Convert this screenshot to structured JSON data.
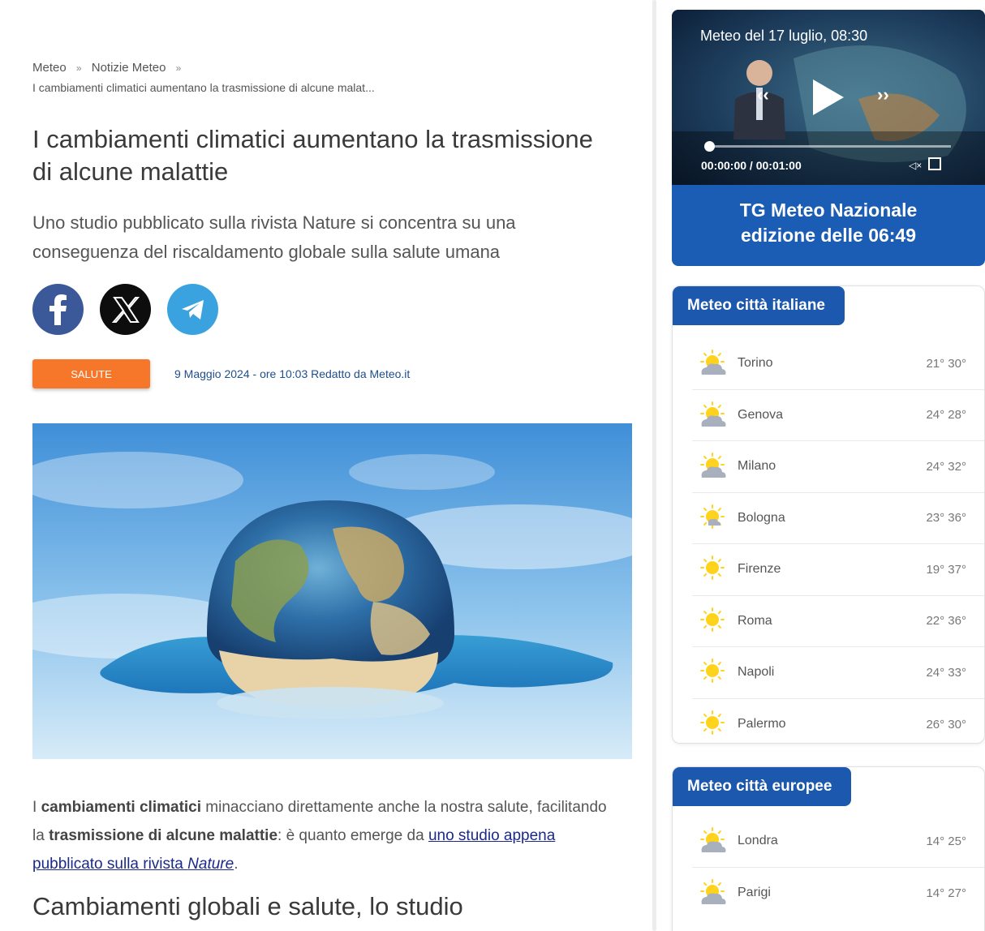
{
  "breadcrumb": {
    "items": [
      "Meteo",
      "Notizie Meteo"
    ],
    "separator": "»",
    "current": "I cambiamenti climatici aumentano la trasmissione di alcune malat..."
  },
  "article": {
    "title": "I cambiamenti climatici aumentano la trasmissione di alcune malattie",
    "subtitle": "Uno studio pubblicato sulla rivista Nature si concentra su una conseguenza del riscaldamento globale sulla salute umana",
    "share": [
      "facebook-icon",
      "x-icon",
      "telegram-icon"
    ],
    "tag": "SALUTE",
    "dateline": "9 Maggio 2024 - ore 10:03 Redatto da Meteo.it",
    "body": {
      "t1": "I ",
      "b1": "cambiamenti climatici",
      "t2": " minacciano direttamente anche la nostra salute, facilitando la ",
      "b2": "trasmissione di alcune malattie",
      "t3": ": è quanto emerge da ",
      "link1": "uno studio appena pubblicato sulla rivista ",
      "link_italic": "Nature",
      "t4": "."
    },
    "section_heading": "Cambiamenti globali e salute, lo studio"
  },
  "video": {
    "title": "Meteo del 17 luglio, 08:30",
    "timecode": "00:00:00 / 00:01:00",
    "progress": 0,
    "mute_label": "◁×",
    "caption_line1": "TG Meteo Nazionale",
    "caption_line2": "edizione delle 06:49"
  },
  "cities_it": {
    "title": "Meteo città italiane",
    "rows": [
      {
        "name": "Torino",
        "temps": "21° 30°",
        "icon": "sun-cloud-icon"
      },
      {
        "name": "Genova",
        "temps": "24° 28°",
        "icon": "sun-cloud-icon"
      },
      {
        "name": "Milano",
        "temps": "24° 32°",
        "icon": "sun-cloud-icon"
      },
      {
        "name": "Bologna",
        "temps": "23° 36°",
        "icon": "sun-small-cloud-icon"
      },
      {
        "name": "Firenze",
        "temps": "19° 37°",
        "icon": "sun-icon"
      },
      {
        "name": "Roma",
        "temps": "22° 36°",
        "icon": "sun-icon"
      },
      {
        "name": "Napoli",
        "temps": "24° 33°",
        "icon": "sun-icon"
      },
      {
        "name": "Palermo",
        "temps": "26° 30°",
        "icon": "sun-icon"
      }
    ]
  },
  "cities_eu": {
    "title": "Meteo città europee",
    "rows": [
      {
        "name": "Londra",
        "temps": "14° 25°",
        "icon": "sun-cloud-icon"
      },
      {
        "name": "Parigi",
        "temps": "14° 27°",
        "icon": "sun-cloud-icon"
      }
    ]
  },
  "colors": {
    "brand_blue": "#1c58ad",
    "tag_orange": "#f6772a",
    "facebook": "#3b5998",
    "telegram": "#3aa3df"
  }
}
